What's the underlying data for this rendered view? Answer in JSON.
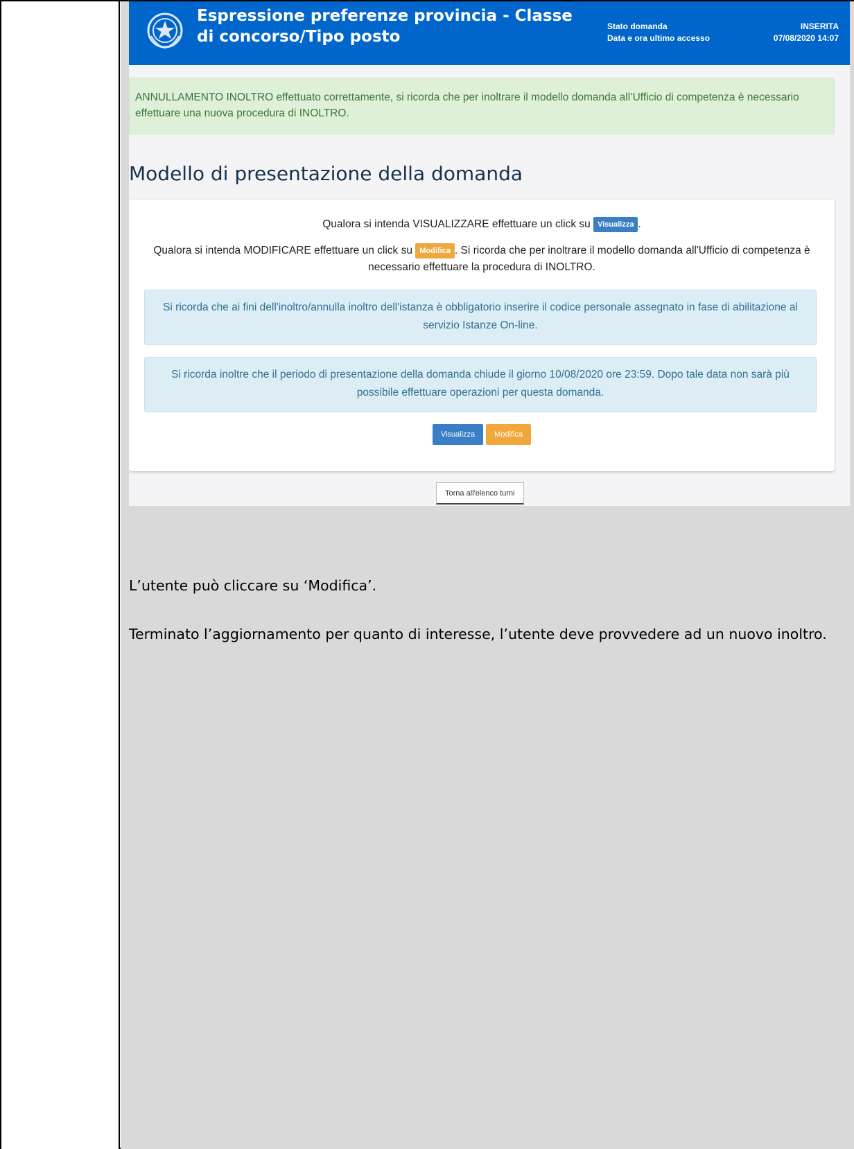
{
  "header": {
    "title": "Espressione preferenze provincia - Classe di concorso/Tipo posto",
    "status_label": "Stato domanda",
    "status_value": "INSERITA",
    "access_label": "Data e ora ultimo accesso",
    "access_value": "07/08/2020 14:07"
  },
  "success_alert": "ANNULLAMENTO INOLTRO effettuato correttamente, si ricorda che per inoltrare il modello domanda all’Ufficio di competenza è necessario effettuare una nuova procedura di INOLTRO.",
  "section_title": "Modello di presentazione della domanda",
  "card": {
    "view_line_prefix": "Qualora si intenda VISUALIZZARE effettuare un click su",
    "view_inline_button": "Visualizza",
    "view_line_suffix": ".",
    "modify_line_prefix": "Qualora si intenda MODIFICARE effettuare un click su",
    "modify_inline_button": "Modifica",
    "modify_line_suffix": ". Si ricorda che per inoltrare il modello domanda all'Ufficio di competenza è necessario effettuare la procedura di INOLTRO.",
    "info_1": "Si ricorda che ai fini dell'inoltro/annulla inoltro dell'istanza è obbligatorio inserire il codice personale assegnato in fase di abilitazione al servizio Istanze On-line.",
    "info_2": "Si ricorda inoltre che il periodo di presentazione della domanda chiude il giorno 10/08/2020 ore 23:59. Dopo tale data non sarà più possibile effettuare operazioni per questa domanda.",
    "view_button": "Visualizza",
    "modify_button": "Modifica"
  },
  "back_button": "Torna all'elenco turni",
  "body_paragraphs": [
    "L’utente può cliccare su ‘Modifica’.",
    "Terminato l’aggiornamento per quanto di interesse, l’utente deve provvedere ad un nuovo inoltro."
  ],
  "colors": {
    "header_blue": "#0066cc",
    "success_bg": "#dff0d8",
    "info_bg": "#dcedf6",
    "button_blue": "#3a7fc6",
    "button_orange": "#f0a73c",
    "cell_gray": "#d9d9d9"
  }
}
